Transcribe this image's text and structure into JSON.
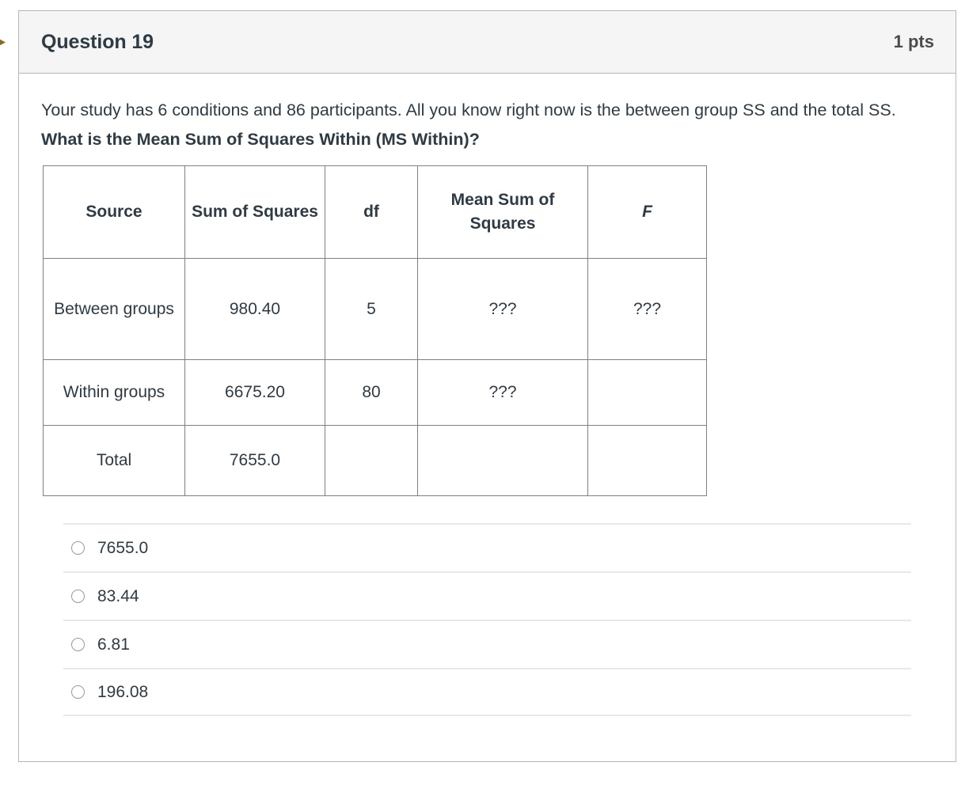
{
  "flag": {
    "icon": "arrow-right-icon",
    "color": "#8a6d1d"
  },
  "header": {
    "title": "Question 19",
    "points": "1 pts"
  },
  "question": {
    "text_plain": "Your study has 6 conditions and 86 participants. All you know right now is the between group SS and the total SS. What is the Mean Sum of Squares Within (MS Within)?",
    "text_normal": "Your study has 6 conditions and 86 participants. All you know right now is the between group SS and the total SS. ",
    "text_bold": "What is the Mean Sum of Squares Within (MS Within)?"
  },
  "table": {
    "headers": [
      "Source",
      "Sum of Squares",
      "df",
      "Mean Sum of Squares",
      "F"
    ],
    "rows": [
      {
        "source": "Between groups",
        "ss": "980.40",
        "df": "5",
        "mss": "???",
        "f": "???"
      },
      {
        "source": "Within groups",
        "ss": "6675.20",
        "df": "80",
        "mss": "???",
        "f": ""
      },
      {
        "source": "Total",
        "ss": "7655.0",
        "df": "",
        "mss": "",
        "f": ""
      }
    ]
  },
  "answers": [
    {
      "label": "7655.0",
      "selected": false
    },
    {
      "label": "83.44",
      "selected": false
    },
    {
      "label": "6.81",
      "selected": false
    },
    {
      "label": "196.08",
      "selected": false
    }
  ],
  "colors": {
    "text": "#2d3b45",
    "header_bg": "#f5f5f5",
    "container_border": "#b7b7b7",
    "table_border": "#808080",
    "divider": "#e8e8e8"
  }
}
